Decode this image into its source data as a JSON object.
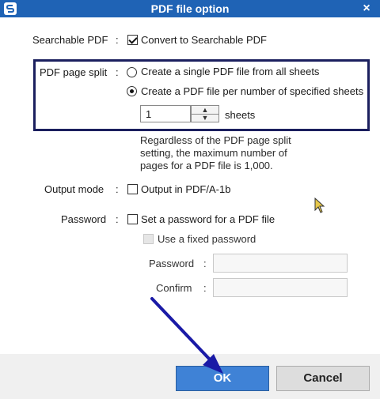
{
  "window": {
    "title": "PDF file option",
    "close_glyph": "×"
  },
  "searchable": {
    "label": "Searchable PDF",
    "colon": ":",
    "option_label": "Convert to Searchable PDF",
    "checked": true
  },
  "split": {
    "label": "PDF page split",
    "colon": ":",
    "options": [
      {
        "label": "Create a single PDF file from all sheets",
        "selected": false
      },
      {
        "label": "Create a PDF file per number of specified sheets",
        "selected": true
      }
    ],
    "sheets_value": "1",
    "sheets_unit": "sheets",
    "note": "Regardless of the PDF page split setting, the maximum number of pages for a PDF file is 1,000."
  },
  "output_mode": {
    "label": "Output mode",
    "colon": ":",
    "option_label": "Output in PDF/A-1b",
    "checked": false
  },
  "password": {
    "label": "Password",
    "colon": ":",
    "option_label": "Set a password for a PDF file",
    "checked": false,
    "fixed_label": "Use a fixed password",
    "password_field_label": "Password",
    "confirm_field_label": "Confirm",
    "field_colon": ":"
  },
  "buttons": {
    "ok": "OK",
    "cancel": "Cancel"
  },
  "colors": {
    "titlebar": "#1f63b5",
    "highlight_box": "#1b1f5e",
    "annotation_arrow": "#1a1aa6",
    "ok_button": "#3f82d6"
  },
  "icons": [
    "scansnap-app-icon",
    "close-icon",
    "mouse-pointer-icon",
    "annotation-arrow"
  ]
}
